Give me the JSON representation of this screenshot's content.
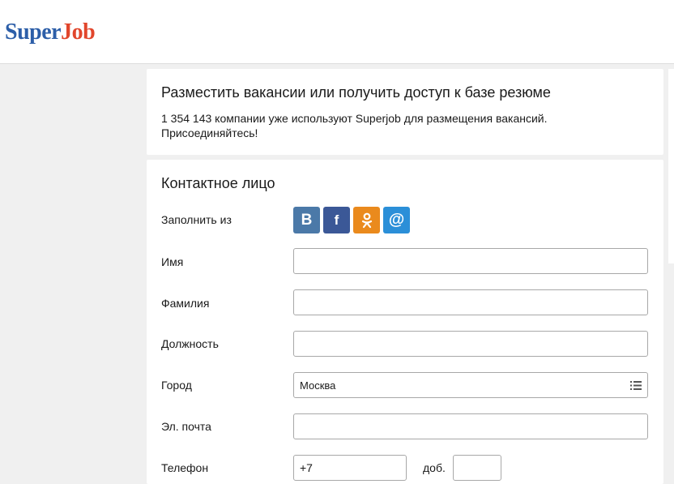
{
  "header": {
    "logo_part1": "Super",
    "logo_part2": "Job",
    "colors": {
      "logo_blue": "#2c5ea8",
      "logo_red": "#e1462c"
    }
  },
  "promo": {
    "title": "Разместить вакансии или получить доступ к базе резюме",
    "text": "1 354 143 компании уже используют Superjob для размещения вакансий. Присоединяйтесь!"
  },
  "form": {
    "title": "Контактное лицо",
    "fill_from_label": "Заполнить из",
    "social": {
      "vk": {
        "glyph": "В",
        "icon": "vk-icon",
        "color": "#4b79a8"
      },
      "fb": {
        "glyph": "f",
        "icon": "facebook-icon",
        "color": "#3b5897"
      },
      "ok": {
        "icon": "odnoklassniki-icon",
        "color": "#ea8a1d"
      },
      "mail": {
        "glyph": "@",
        "icon": "mail-ru-icon",
        "color": "#2b8fd8"
      }
    },
    "fields": {
      "first_name": {
        "label": "Имя",
        "value": ""
      },
      "last_name": {
        "label": "Фамилия",
        "value": ""
      },
      "position": {
        "label": "Должность",
        "value": ""
      },
      "city": {
        "label": "Город",
        "value": "Москва",
        "icon": "list-icon"
      },
      "email": {
        "label": "Эл. почта",
        "value": ""
      },
      "phone": {
        "label": "Телефон",
        "value": "+7",
        "ext_label": "доб.",
        "ext_value": ""
      }
    }
  }
}
